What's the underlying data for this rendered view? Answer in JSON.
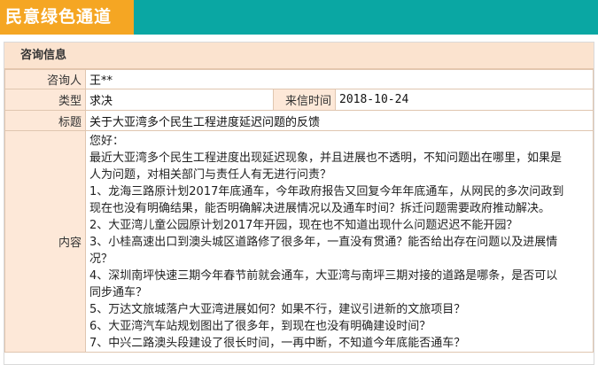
{
  "header": {
    "title": "民意绿色通道"
  },
  "section": {
    "title": "咨询信息"
  },
  "labels": {
    "inquirer": "咨询人",
    "type": "类型",
    "date": "来信时间",
    "subject": "标题",
    "content": "内容"
  },
  "values": {
    "inquirer": "王**",
    "type": "求决",
    "date": "2018-10-24",
    "subject": "关于大亚湾多个民生工程进度延迟问题的反馈"
  },
  "content_lines": [
    "您好：",
    "最近大亚湾多个民生工程进度出现延迟现象，并且进展也不透明，不知问题出在哪里，如果是",
    "人为问题，对相关部门与责任人有无进行问责？",
    "1、龙海三路原计划2017年底通车，今年政府报告又回复今年年底通车，从网民的多次问政到",
    "现在也没有明确结果，能否明确解决进展情况以及通车时间？拆迁问题需要政府推动解决。",
    "2、大亚湾儿童公园原计划2017年开园，现在也不知道出现什么问题迟迟不能开园？",
    "3、小桂高速出口到澳头城区道路修了很多年，一直没有贯通？能否给出存在问题以及进展情",
    "况？",
    "4、深圳南坪快速三期今年春节前就会通车，大亚湾与南坪三期对接的道路是哪条，是否可以",
    "同步通车？",
    "5、万达文旅城落户大亚湾进展如何？如果不行，建议引进新的文旅项目？",
    "6、大亚湾汽车站规划图出了很多年，到现在也没有明确建设时间？",
    "7、中兴二路澳头段建设了很长时间，一再中断，不知道今年底能否通车？"
  ]
}
